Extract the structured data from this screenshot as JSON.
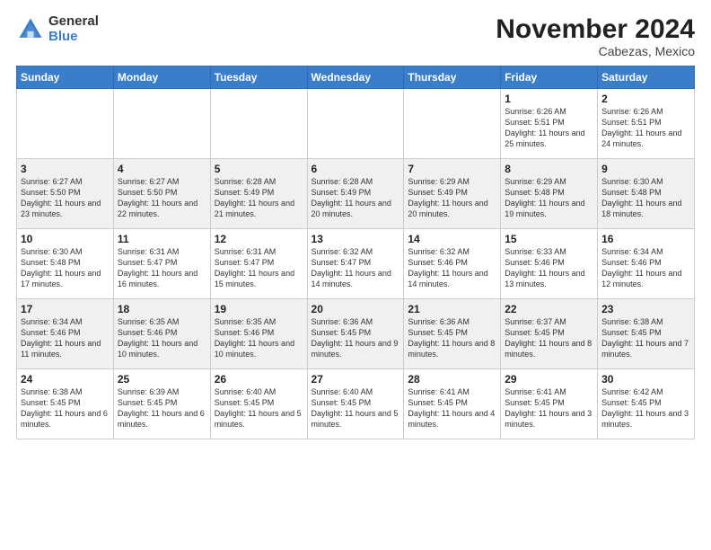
{
  "logo": {
    "general": "General",
    "blue": "Blue"
  },
  "header": {
    "month": "November 2024",
    "location": "Cabezas, Mexico"
  },
  "weekdays": [
    "Sunday",
    "Monday",
    "Tuesday",
    "Wednesday",
    "Thursday",
    "Friday",
    "Saturday"
  ],
  "weeks": [
    [
      {
        "day": "",
        "info": ""
      },
      {
        "day": "",
        "info": ""
      },
      {
        "day": "",
        "info": ""
      },
      {
        "day": "",
        "info": ""
      },
      {
        "day": "",
        "info": ""
      },
      {
        "day": "1",
        "info": "Sunrise: 6:26 AM\nSunset: 5:51 PM\nDaylight: 11 hours\nand 25 minutes."
      },
      {
        "day": "2",
        "info": "Sunrise: 6:26 AM\nSunset: 5:51 PM\nDaylight: 11 hours\nand 24 minutes."
      }
    ],
    [
      {
        "day": "3",
        "info": "Sunrise: 6:27 AM\nSunset: 5:50 PM\nDaylight: 11 hours\nand 23 minutes."
      },
      {
        "day": "4",
        "info": "Sunrise: 6:27 AM\nSunset: 5:50 PM\nDaylight: 11 hours\nand 22 minutes."
      },
      {
        "day": "5",
        "info": "Sunrise: 6:28 AM\nSunset: 5:49 PM\nDaylight: 11 hours\nand 21 minutes."
      },
      {
        "day": "6",
        "info": "Sunrise: 6:28 AM\nSunset: 5:49 PM\nDaylight: 11 hours\nand 20 minutes."
      },
      {
        "day": "7",
        "info": "Sunrise: 6:29 AM\nSunset: 5:49 PM\nDaylight: 11 hours\nand 20 minutes."
      },
      {
        "day": "8",
        "info": "Sunrise: 6:29 AM\nSunset: 5:48 PM\nDaylight: 11 hours\nand 19 minutes."
      },
      {
        "day": "9",
        "info": "Sunrise: 6:30 AM\nSunset: 5:48 PM\nDaylight: 11 hours\nand 18 minutes."
      }
    ],
    [
      {
        "day": "10",
        "info": "Sunrise: 6:30 AM\nSunset: 5:48 PM\nDaylight: 11 hours\nand 17 minutes."
      },
      {
        "day": "11",
        "info": "Sunrise: 6:31 AM\nSunset: 5:47 PM\nDaylight: 11 hours\nand 16 minutes."
      },
      {
        "day": "12",
        "info": "Sunrise: 6:31 AM\nSunset: 5:47 PM\nDaylight: 11 hours\nand 15 minutes."
      },
      {
        "day": "13",
        "info": "Sunrise: 6:32 AM\nSunset: 5:47 PM\nDaylight: 11 hours\nand 14 minutes."
      },
      {
        "day": "14",
        "info": "Sunrise: 6:32 AM\nSunset: 5:46 PM\nDaylight: 11 hours\nand 14 minutes."
      },
      {
        "day": "15",
        "info": "Sunrise: 6:33 AM\nSunset: 5:46 PM\nDaylight: 11 hours\nand 13 minutes."
      },
      {
        "day": "16",
        "info": "Sunrise: 6:34 AM\nSunset: 5:46 PM\nDaylight: 11 hours\nand 12 minutes."
      }
    ],
    [
      {
        "day": "17",
        "info": "Sunrise: 6:34 AM\nSunset: 5:46 PM\nDaylight: 11 hours\nand 11 minutes."
      },
      {
        "day": "18",
        "info": "Sunrise: 6:35 AM\nSunset: 5:46 PM\nDaylight: 11 hours\nand 10 minutes."
      },
      {
        "day": "19",
        "info": "Sunrise: 6:35 AM\nSunset: 5:46 PM\nDaylight: 11 hours\nand 10 minutes."
      },
      {
        "day": "20",
        "info": "Sunrise: 6:36 AM\nSunset: 5:45 PM\nDaylight: 11 hours\nand 9 minutes."
      },
      {
        "day": "21",
        "info": "Sunrise: 6:36 AM\nSunset: 5:45 PM\nDaylight: 11 hours\nand 8 minutes."
      },
      {
        "day": "22",
        "info": "Sunrise: 6:37 AM\nSunset: 5:45 PM\nDaylight: 11 hours\nand 8 minutes."
      },
      {
        "day": "23",
        "info": "Sunrise: 6:38 AM\nSunset: 5:45 PM\nDaylight: 11 hours\nand 7 minutes."
      }
    ],
    [
      {
        "day": "24",
        "info": "Sunrise: 6:38 AM\nSunset: 5:45 PM\nDaylight: 11 hours\nand 6 minutes."
      },
      {
        "day": "25",
        "info": "Sunrise: 6:39 AM\nSunset: 5:45 PM\nDaylight: 11 hours\nand 6 minutes."
      },
      {
        "day": "26",
        "info": "Sunrise: 6:40 AM\nSunset: 5:45 PM\nDaylight: 11 hours\nand 5 minutes."
      },
      {
        "day": "27",
        "info": "Sunrise: 6:40 AM\nSunset: 5:45 PM\nDaylight: 11 hours\nand 5 minutes."
      },
      {
        "day": "28",
        "info": "Sunrise: 6:41 AM\nSunset: 5:45 PM\nDaylight: 11 hours\nand 4 minutes."
      },
      {
        "day": "29",
        "info": "Sunrise: 6:41 AM\nSunset: 5:45 PM\nDaylight: 11 hours\nand 3 minutes."
      },
      {
        "day": "30",
        "info": "Sunrise: 6:42 AM\nSunset: 5:45 PM\nDaylight: 11 hours\nand 3 minutes."
      }
    ]
  ]
}
